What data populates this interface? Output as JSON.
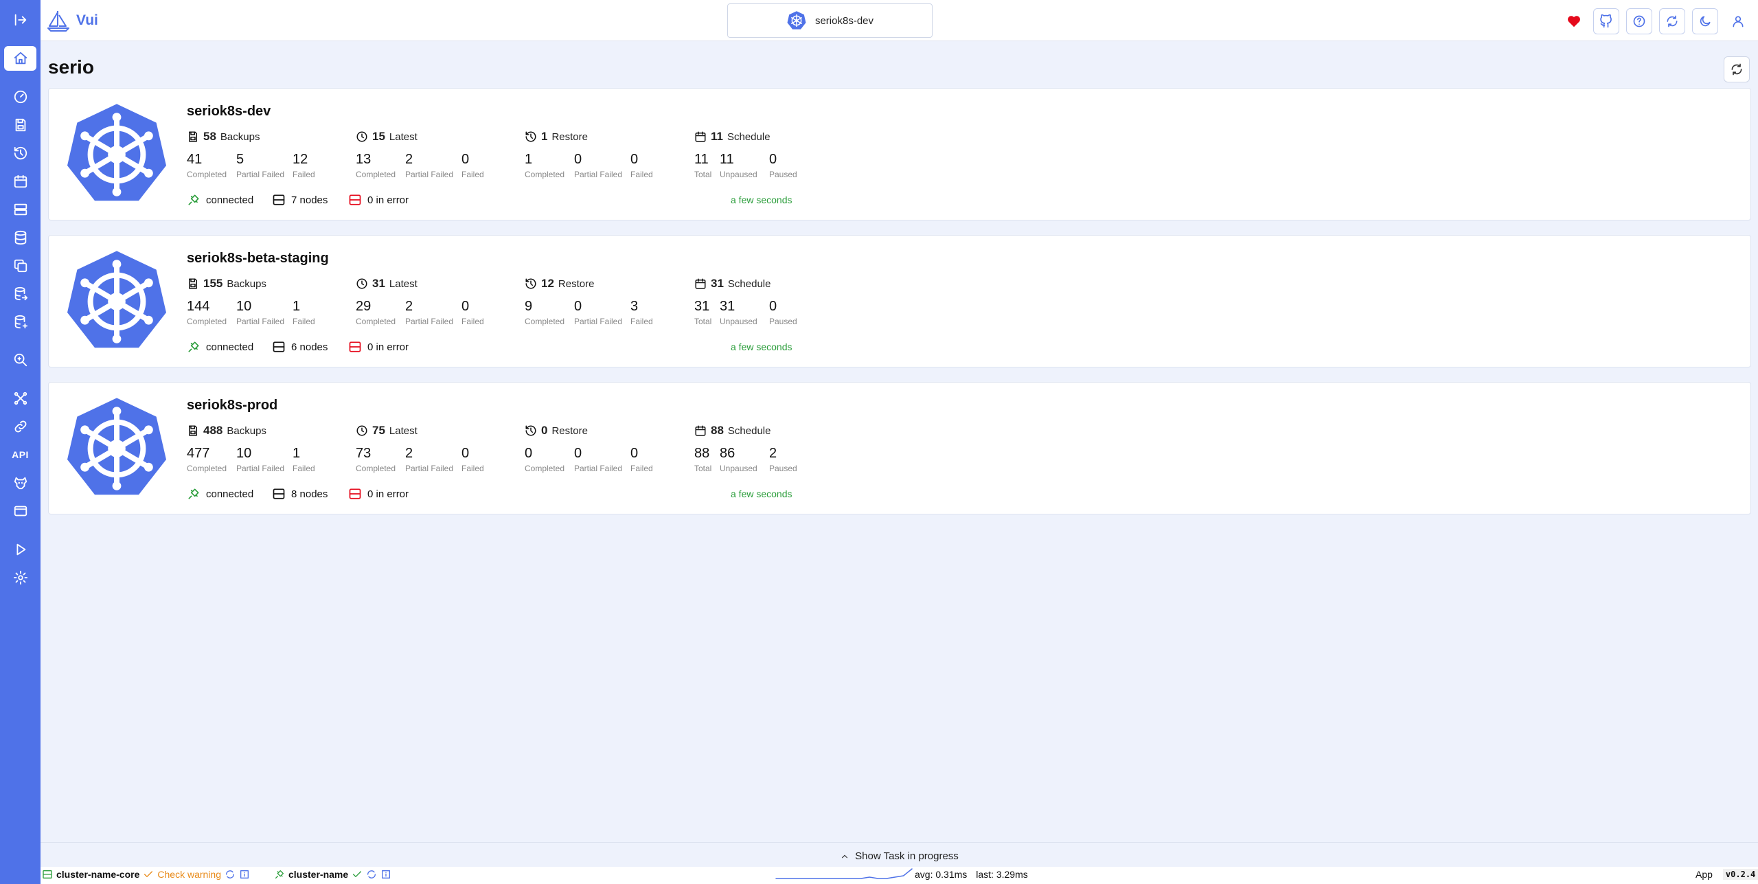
{
  "app": {
    "name": "Vui"
  },
  "header": {
    "selected_cluster": "seriok8s-dev"
  },
  "page": {
    "title": "serio"
  },
  "clusters": [
    {
      "name": "seriok8s-dev",
      "backups": {
        "total": "58",
        "label": "Backups",
        "completed": "41",
        "partial_failed": "5",
        "failed": "12"
      },
      "latest": {
        "total": "15",
        "label": "Latest",
        "completed": "13",
        "partial_failed": "2",
        "failed": "0"
      },
      "restore": {
        "total": "1",
        "label": "Restore",
        "completed": "1",
        "partial_failed": "0",
        "failed": "0"
      },
      "schedule": {
        "total": "11",
        "label": "Schedule",
        "total_count": "11",
        "unpaused": "11",
        "paused": "0"
      },
      "status": "connected",
      "nodes": "7 nodes",
      "errors": "0 in error",
      "updated": "a few seconds"
    },
    {
      "name": "seriok8s-beta-staging",
      "backups": {
        "total": "155",
        "label": "Backups",
        "completed": "144",
        "partial_failed": "10",
        "failed": "1"
      },
      "latest": {
        "total": "31",
        "label": "Latest",
        "completed": "29",
        "partial_failed": "2",
        "failed": "0"
      },
      "restore": {
        "total": "12",
        "label": "Restore",
        "completed": "9",
        "partial_failed": "0",
        "failed": "3"
      },
      "schedule": {
        "total": "31",
        "label": "Schedule",
        "total_count": "31",
        "unpaused": "31",
        "paused": "0"
      },
      "status": "connected",
      "nodes": "6 nodes",
      "errors": "0 in error",
      "updated": "a few seconds"
    },
    {
      "name": "seriok8s-prod",
      "backups": {
        "total": "488",
        "label": "Backups",
        "completed": "477",
        "partial_failed": "10",
        "failed": "1"
      },
      "latest": {
        "total": "75",
        "label": "Latest",
        "completed": "73",
        "partial_failed": "2",
        "failed": "0"
      },
      "restore": {
        "total": "0",
        "label": "Restore",
        "completed": "0",
        "partial_failed": "0",
        "failed": "0"
      },
      "schedule": {
        "total": "88",
        "label": "Schedule",
        "total_count": "88",
        "unpaused": "86",
        "paused": "2"
      },
      "status": "connected",
      "nodes": "8 nodes",
      "errors": "0 in error",
      "updated": "a few seconds"
    }
  ],
  "labels": {
    "completed": "Completed",
    "partial_failed": "Partial Failed",
    "failed": "Failed",
    "total": "Total",
    "unpaused": "Unpaused",
    "paused": "Paused"
  },
  "taskbar": {
    "label": "Show Task in progress"
  },
  "statusbar": {
    "core_name": "cluster-name-core",
    "core_status": "Check warning",
    "cluster_name": "cluster-name",
    "avg": "avg: 0.31ms",
    "last": "last: 3.29ms",
    "app_label": "App",
    "version": "v0.2.4"
  },
  "colors": {
    "primary": "#4f72e8",
    "success": "#2a9d3a",
    "error": "#e5091b",
    "warning": "#e88a18"
  },
  "sparkline": [
    2,
    2,
    2,
    2,
    2,
    2,
    2,
    2,
    2,
    2,
    2,
    3,
    2,
    2,
    3,
    4,
    9
  ]
}
